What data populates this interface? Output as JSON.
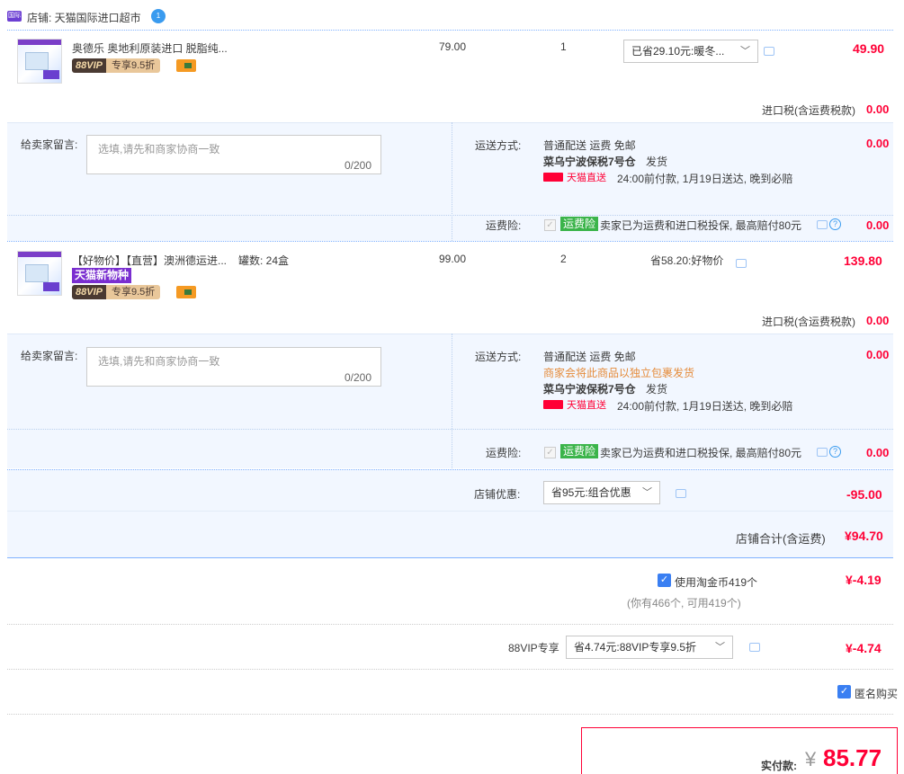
{
  "shop": {
    "label": "店铺: 天猫国际进口超市",
    "icon": "tmall-intl-shop-icon",
    "badge_icon": "wangwang-icon",
    "shop_icon_text": "国际",
    "ww_text": "1"
  },
  "items": [
    {
      "title": "奥德乐 奥地利原装进口 脱脂纯...",
      "tags": [],
      "vip_a": "88VIP",
      "vip_b": "专享9.5折",
      "price": "79.00",
      "qty": "1",
      "promo": "已省29.10元:暖冬...",
      "total": "49.90",
      "tax_label": "进口税(含运费税款)",
      "tax_value": "0.00",
      "note_label": "给卖家留言:",
      "note_placeholder": "选填,请先和商家协商一致",
      "note_count": "0/200",
      "ship_label": "运送方式:",
      "ship_method": "普通配送 运费 免邮",
      "ship_extra": "",
      "warehouse": "菜乌宁波保税7号仓",
      "warehouse_suffix": "发货",
      "tmall_direct": "天猫直送",
      "delivery": "24:00前付款, 1月19日送达, 晚到必赔",
      "ship_value": "0.00",
      "ins_label": "运费险:",
      "ins_tag": "运费险",
      "ins_text": "卖家已为运费和进口税投保, 最高赔付80元",
      "ins_value": "0.00"
    },
    {
      "title": "【好物价】【直营】澳洲德运进...",
      "spec": "罐数: 24盒",
      "tag": "天猫新物种",
      "vip_a": "88VIP",
      "vip_b": "专享9.5折",
      "price": "99.00",
      "qty": "2",
      "promo": "省58.20:好物价",
      "total": "139.80",
      "tax_label": "进口税(含运费税款)",
      "tax_value": "0.00",
      "note_label": "给卖家留言:",
      "note_placeholder": "选填,请先和商家协商一致",
      "note_count": "0/200",
      "ship_label": "运送方式:",
      "ship_method": "普通配送 运费 免邮",
      "ship_extra": "商家会将此商品以独立包裹发货",
      "warehouse": "菜乌宁波保税7号仓",
      "warehouse_suffix": "发货",
      "tmall_direct": "天猫直送",
      "delivery": "24:00前付款, 1月19日送达, 晚到必赔",
      "ship_value": "0.00",
      "ins_label": "运费险:",
      "ins_tag": "运费险",
      "ins_text": "卖家已为运费和进口税投保, 最高赔付80元",
      "ins_value": "0.00"
    }
  ],
  "shop_discount": {
    "label": "店铺优惠:",
    "select": "省95元:组合优惠",
    "value": "-95.00"
  },
  "shop_total": {
    "label": "店铺合计(含运费)",
    "value": "¥94.70"
  },
  "coins": {
    "label": "使用淘金币419个",
    "hint": "(你有466个, 可用419个)",
    "value": "¥-4.19"
  },
  "vip": {
    "label": "88VIP专享",
    "select": "省4.74元:88VIP专享9.5折",
    "value": "¥-4.74"
  },
  "anonymous": {
    "label": "匿名购买"
  },
  "pay": {
    "label": "实付款:",
    "currency": "¥",
    "amount": "85.77"
  },
  "colors": {
    "accent": "#ff0036",
    "panel": "#f2f7ff",
    "checkbox": "#3a7ff2"
  }
}
